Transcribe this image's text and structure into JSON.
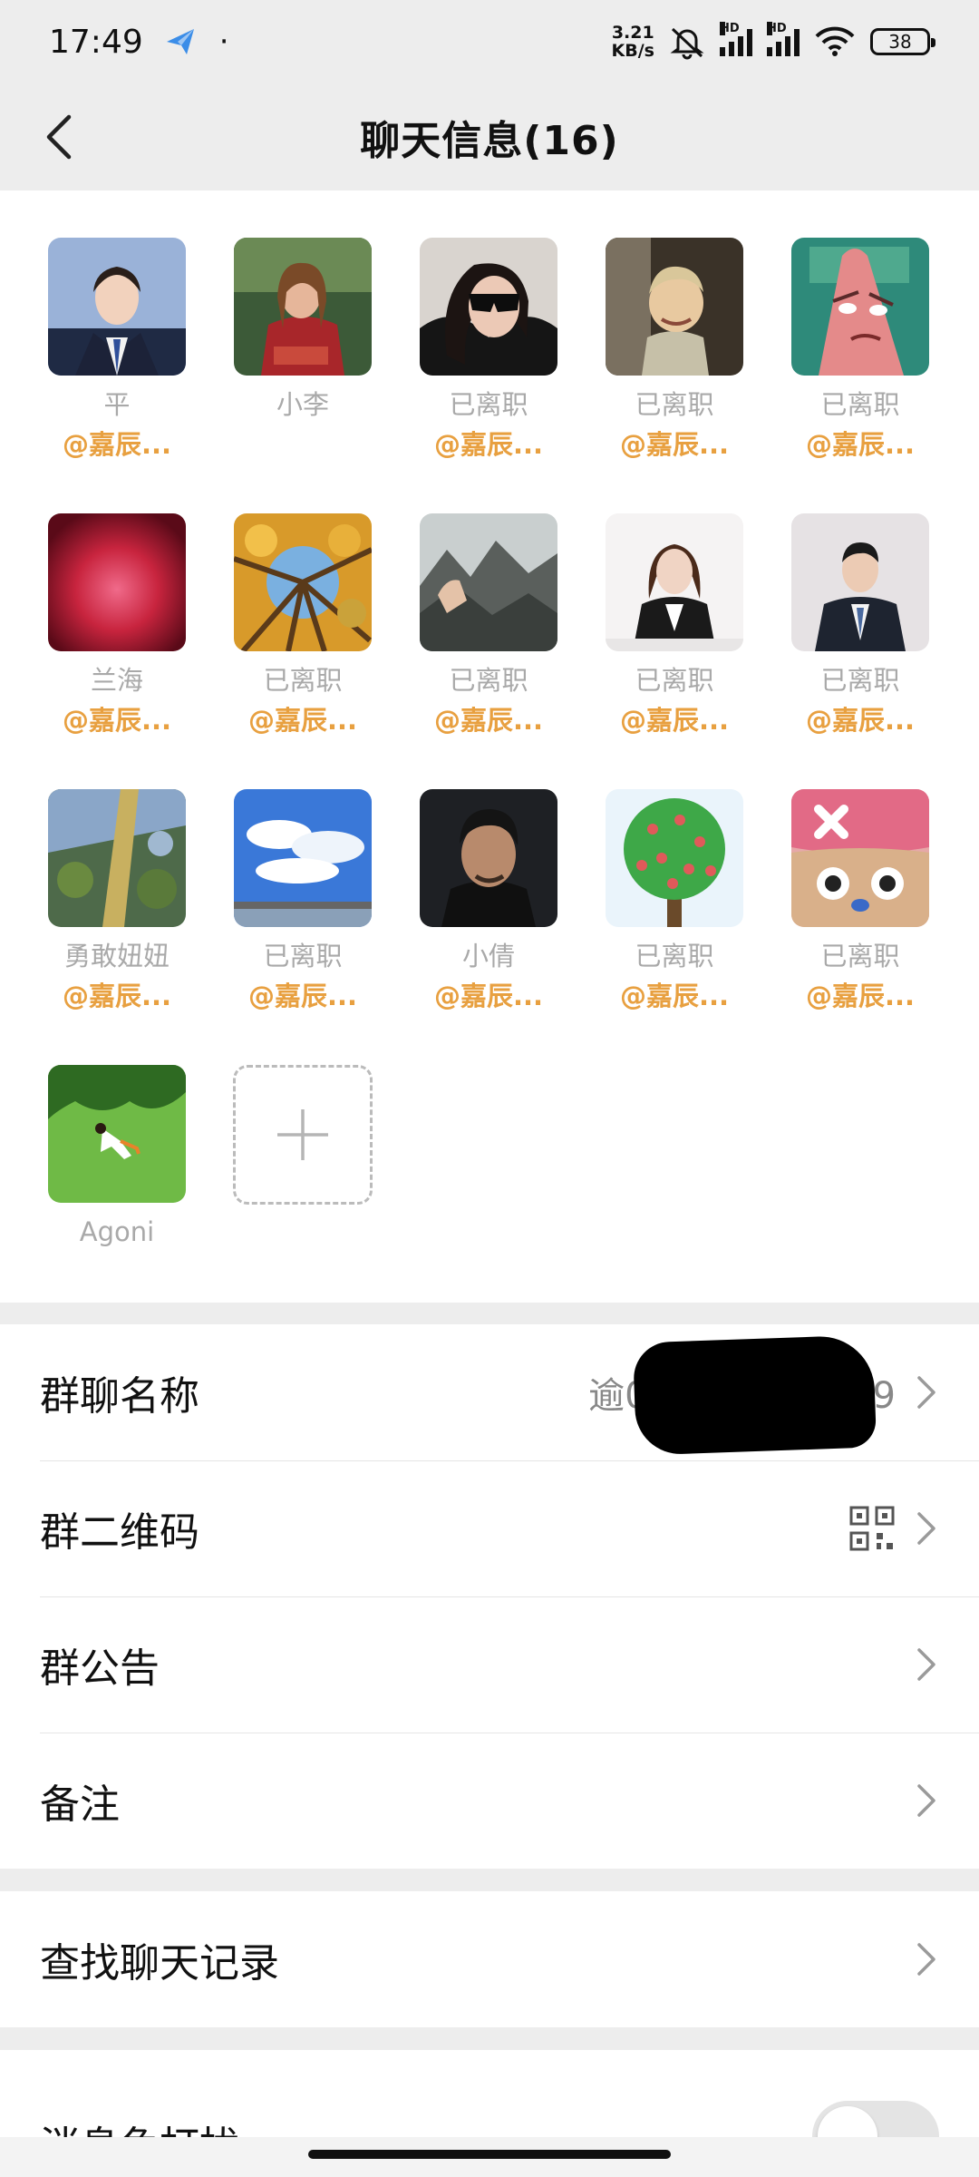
{
  "status_bar": {
    "time": "17:49",
    "dot": "·",
    "net_speed_value": "3.21",
    "net_speed_unit": "KB/s",
    "hd_label": "HD",
    "battery": "38"
  },
  "nav": {
    "title": "聊天信息(16)"
  },
  "members": [
    {
      "name": "平",
      "tag": "@嘉辰..."
    },
    {
      "name": "小李",
      "tag": ""
    },
    {
      "name": "已离职",
      "tag": "@嘉辰..."
    },
    {
      "name": "已离职",
      "tag": "@嘉辰..."
    },
    {
      "name": "已离职",
      "tag": "@嘉辰..."
    },
    {
      "name": "兰海",
      "tag": "@嘉辰..."
    },
    {
      "name": "已离职",
      "tag": "@嘉辰..."
    },
    {
      "name": "已离职",
      "tag": "@嘉辰..."
    },
    {
      "name": "已离职",
      "tag": "@嘉辰..."
    },
    {
      "name": "已离职",
      "tag": "@嘉辰..."
    },
    {
      "name": "勇敢妞妞",
      "tag": "@嘉辰..."
    },
    {
      "name": "已离职",
      "tag": "@嘉辰..."
    },
    {
      "name": "小倩",
      "tag": "@嘉辰..."
    },
    {
      "name": "已离职",
      "tag": "@嘉辰..."
    },
    {
      "name": "已离职",
      "tag": "@嘉辰..."
    },
    {
      "name": "Agoni",
      "tag": ""
    }
  ],
  "settings": {
    "group_name_label": "群聊名称",
    "group_name_value_start": "逾0",
    "group_name_value_end": "9",
    "qr_label": "群二维码",
    "notice_label": "群公告",
    "remark_label": "备注",
    "search_label": "查找聊天记录",
    "mute_label": "消息免打扰",
    "mute_on": false
  },
  "colors": {
    "tag": "#e8a040",
    "name": "#a9a9a9",
    "background": "#ededed"
  },
  "icons": [
    "back-arrow-icon",
    "plus-icon",
    "qr-code-icon",
    "chevron-right-icon",
    "wifi-icon",
    "mute-bell-icon"
  ]
}
